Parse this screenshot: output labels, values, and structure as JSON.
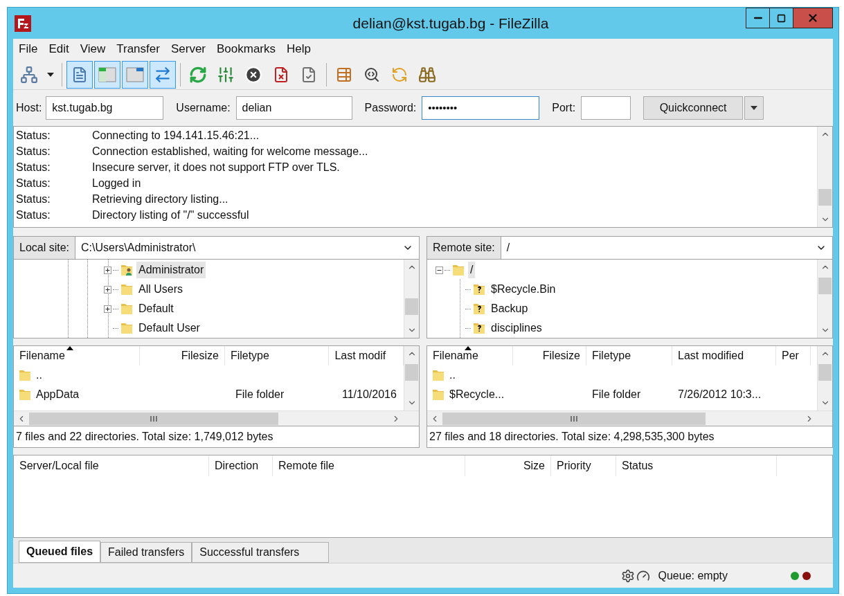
{
  "window": {
    "title": "delian@kst.tugab.bg - FileZilla"
  },
  "menu": [
    "File",
    "Edit",
    "View",
    "Transfer",
    "Server",
    "Bookmarks",
    "Help"
  ],
  "toolbar": [
    {
      "kind": "site-manager",
      "pressed": false
    },
    {
      "kind": "dropdown",
      "pressed": false
    },
    {
      "kind": "log",
      "pressed": true
    },
    {
      "kind": "local-tree",
      "pressed": true
    },
    {
      "kind": "remote-tree",
      "pressed": true
    },
    {
      "kind": "queue",
      "pressed": true
    },
    {
      "kind": "refresh",
      "pressed": false
    },
    {
      "kind": "filters",
      "pressed": false
    },
    {
      "kind": "cancel",
      "pressed": false
    },
    {
      "kind": "disconnect",
      "pressed": false
    },
    {
      "kind": "reconnect",
      "pressed": false
    },
    {
      "kind": "compare",
      "pressed": false
    },
    {
      "kind": "search",
      "pressed": false
    },
    {
      "kind": "sync",
      "pressed": false
    },
    {
      "kind": "find",
      "pressed": false
    }
  ],
  "quickconnect": {
    "host_label": "Host:",
    "host": "kst.tugab.bg",
    "username_label": "Username:",
    "username": "delian",
    "password_label": "Password:",
    "password": "••••••••",
    "port_label": "Port:",
    "button": "Quickconnect"
  },
  "log": [
    {
      "label": "Status:",
      "message": "Connecting to 194.141.15.46:21..."
    },
    {
      "label": "Status:",
      "message": "Connection established, waiting for welcome message..."
    },
    {
      "label": "Status:",
      "message": "Insecure server, it does not support FTP over TLS."
    },
    {
      "label": "Status:",
      "message": "Logged in"
    },
    {
      "label": "Status:",
      "message": "Retrieving directory listing..."
    },
    {
      "label": "Status:",
      "message": "Directory listing of \"/\" successful"
    }
  ],
  "local": {
    "site_label": "Local site:",
    "path": "C:\\Users\\Administrator\\",
    "tree": [
      {
        "label": "Administrator",
        "kind": "user",
        "selected": true,
        "expanded": false
      },
      {
        "label": "All Users",
        "selected": false,
        "expanded": false
      },
      {
        "label": "Default",
        "selected": false,
        "expanded": false
      },
      {
        "label": "Default User",
        "selected": false
      }
    ],
    "columns": [
      {
        "label": "Filename",
        "sorted": true
      },
      {
        "label": "Filesize",
        "sorted": false
      },
      {
        "label": "Filetype",
        "sorted": false
      },
      {
        "label": "Last modif",
        "sorted": false
      }
    ],
    "rows": [
      {
        "name": ".."
      },
      {
        "name": "AppData",
        "type": "File folder",
        "modified": "11/10/2016"
      }
    ],
    "summary": "7 files and 22 directories. Total size: 1,749,012 bytes"
  },
  "remote": {
    "site_label": "Remote site:",
    "path": "/",
    "tree": [
      {
        "label": "/",
        "selected": true,
        "expanded": true,
        "children": [
          {
            "label": "$Recycle.Bin",
            "kind": "unknown",
            "selected": false
          },
          {
            "label": "Backup",
            "kind": "unknown",
            "selected": false
          },
          {
            "label": "disciplines",
            "kind": "unknown",
            "selected": false
          }
        ]
      }
    ],
    "columns": [
      {
        "label": "Filename",
        "sorted": true
      },
      {
        "label": "Filesize",
        "sorted": false
      },
      {
        "label": "Filetype",
        "sorted": false
      },
      {
        "label": "Last modified",
        "sorted": false
      },
      {
        "label": "Per",
        "sorted": false
      }
    ],
    "rows": [
      {
        "name": ".."
      },
      {
        "name": "$Recycle...",
        "type": "File folder",
        "modified": "7/26/2012 10:3..."
      }
    ],
    "summary": "27 files and 18 directories. Total size: 4,298,535,300 bytes"
  },
  "queue": {
    "columns": [
      "Server/Local file",
      "Direction",
      "Remote file",
      "Size",
      "Priority",
      "Status"
    ],
    "tabs": [
      {
        "label": "Queued files",
        "selected": true
      },
      {
        "label": "Failed transfers",
        "selected": false
      },
      {
        "label": "Successful transfers",
        "selected": false
      }
    ],
    "status": "Queue: empty"
  }
}
